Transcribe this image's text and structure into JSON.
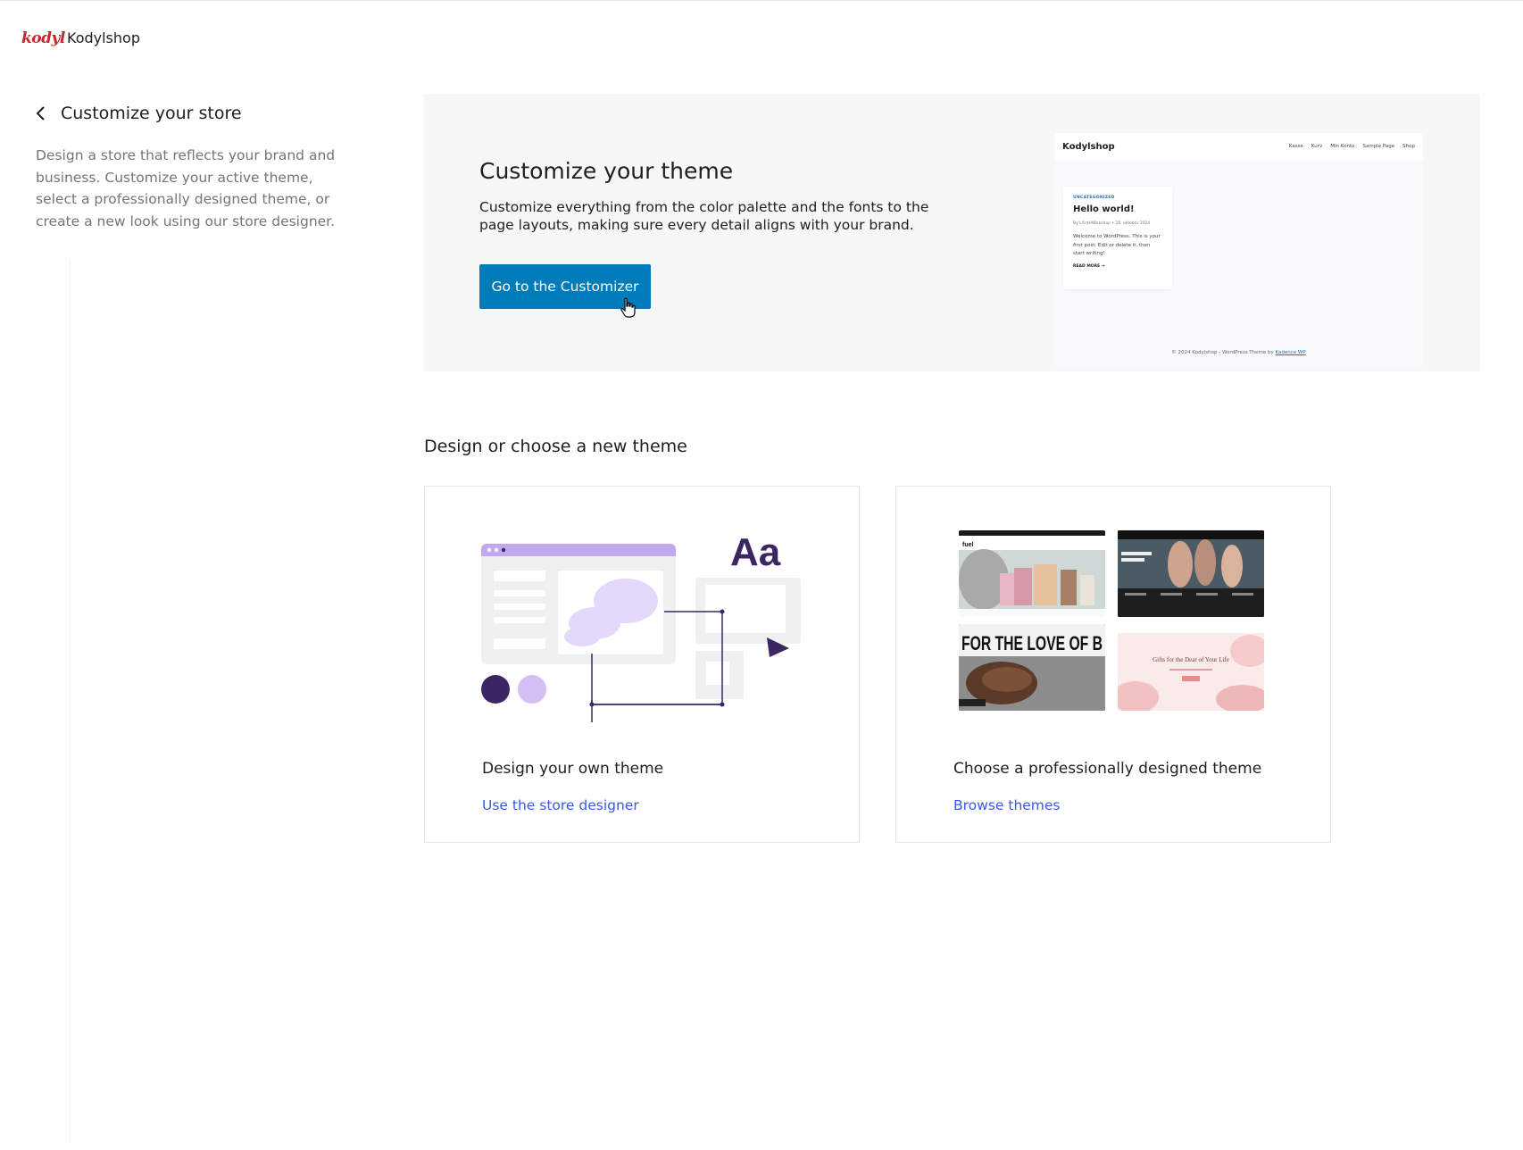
{
  "header": {
    "logo_text": "kodyl",
    "site_name": "Kodylshop"
  },
  "sidebar": {
    "title": "Customize your store",
    "description": "Design a store that reflects your brand and business. Customize your active theme, select a professionally designed theme, or create a new look using our store designer."
  },
  "hero": {
    "title": "Customize your theme",
    "description": "Customize everything from the color palette and the fonts to the page layouts, making sure every detail aligns with your brand.",
    "cta_label": "Go to the Customizer",
    "preview": {
      "brand": "Kodylshop",
      "nav": [
        "Kasse",
        "Kurv",
        "Min Konto",
        "Sample Page",
        "Shop"
      ],
      "post_category": "UNCATEGORIZED",
      "post_title": "Hello world!",
      "post_meta": "By LAr$HWb$shop  •  26. oktober 2024",
      "post_body": "Welcome to WordPress. This is your first post. Edit or delete it, then start writing!",
      "read_more": "READ MORE →",
      "footer_text": "© 2024 Kodylshop - WordPress Theme by ",
      "footer_link": "Kadence WP"
    }
  },
  "section": {
    "title": "Design or choose a new theme"
  },
  "cards": {
    "designer": {
      "illustration_text": "Aa",
      "title": "Design your own theme",
      "link": "Use the store designer"
    },
    "themes": {
      "title": "Choose a professionally designed theme",
      "link": "Browse themes",
      "thumb_fuel_brand": "fuel",
      "thumb_bread_headline": "FOR THE LOVE OF B",
      "thumb_gifts_headline": "Gifts for the Dear of Your Life"
    }
  },
  "colors": {
    "primary": "#007cba",
    "link": "#3858e9",
    "brand_logo": "#c8262d",
    "illustration_purple": "#3c2563",
    "illustration_lavender": "#d4bff5"
  }
}
